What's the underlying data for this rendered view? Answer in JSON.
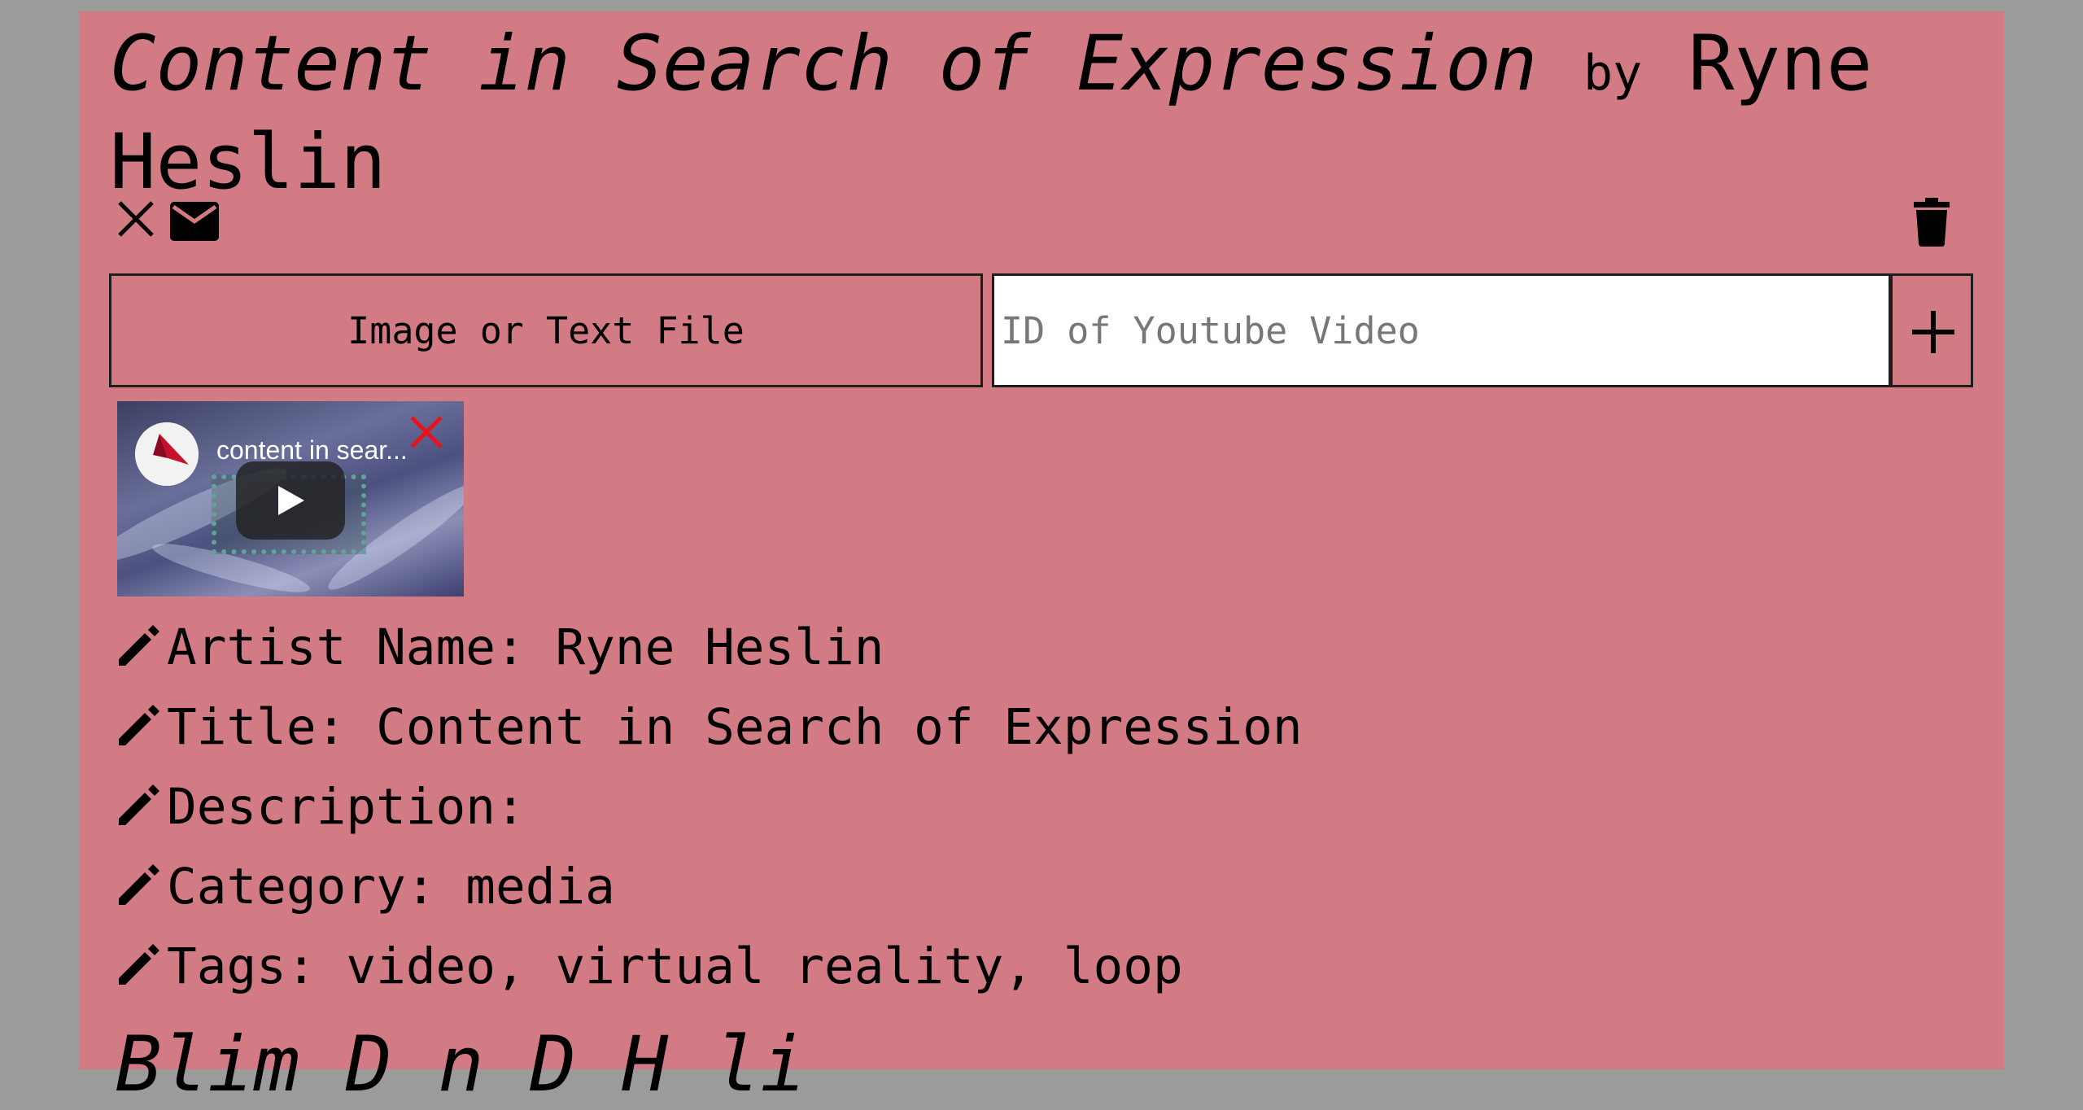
{
  "entry": {
    "title": "Content in Search of Expression",
    "by": "by",
    "artist": "Ryne Heslin"
  },
  "toolbar": {
    "close_icon": "close-icon",
    "mail_icon": "mail-icon",
    "trash_icon": "trash-icon"
  },
  "upload": {
    "file_button_label": "Image or Text File",
    "youtube_placeholder": "ID of Youtube Video",
    "add_icon": "plus-icon"
  },
  "video": {
    "title": "content in sear...",
    "play_icon": "play-icon",
    "remove_icon": "remove-x-icon"
  },
  "fields": [
    {
      "label": "Artist Name:",
      "value": "Ryne Heslin"
    },
    {
      "label": "Title:",
      "value": "Content in Search of Expression"
    },
    {
      "label": "Description:",
      "value": ""
    },
    {
      "label": "Category:",
      "value": "media"
    },
    {
      "label": "Tags:",
      "value": "video, virtual reality, loop"
    }
  ],
  "next_entry": {
    "partial_title": "Blim D n  D  H  li"
  },
  "colors": {
    "page_bg": "#9b9b9b",
    "panel_bg": "#d37b85",
    "remove_red": "#e8121d"
  }
}
